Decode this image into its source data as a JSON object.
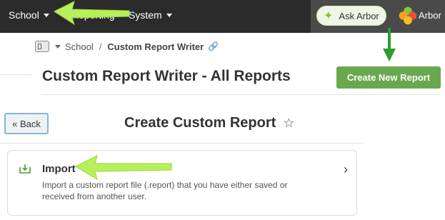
{
  "topbar": {
    "nav": [
      {
        "label": "School"
      },
      {
        "label": "Reporting"
      },
      {
        "label": "System"
      }
    ],
    "ask_label": "Ask Arbor",
    "brand_label": "Arbor"
  },
  "breadcrumb": {
    "root": "School",
    "separator": "/",
    "current": "Custom Report Writer"
  },
  "page": {
    "title": "Custom Report Writer - All Reports",
    "create_button": "Create New Report"
  },
  "dialog": {
    "back_label": "« Back",
    "title": "Create Custom Report",
    "option": {
      "title": "Import",
      "description": "Import a custom report file (.report) that you have either saved or received from another user."
    }
  },
  "colors": {
    "topbar": "#2b2b2b",
    "accent_green": "#6aa84f",
    "annotation_arrow_top": "#b7f05a",
    "annotation_arrow_button": "#2e9c2e"
  }
}
